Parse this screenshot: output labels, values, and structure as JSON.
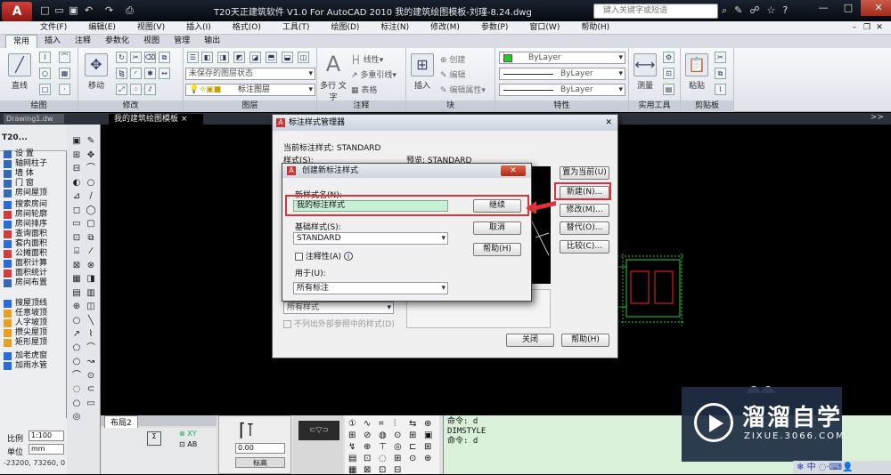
{
  "app": {
    "logo_letter": "A",
    "title": "T20天正建筑软件 V1.0 For AutoCAD 2010    我的建筑绘图模板-刘瑾-8.24.dwg",
    "search_placeholder": "键入关键字或短语"
  },
  "menu": [
    "文件(F)",
    "编辑(E)",
    "视图(V)",
    "插入(I)",
    "格式(O)",
    "工具(T)",
    "绘图(D)",
    "标注(N)",
    "修改(M)",
    "参数(P)",
    "窗口(W)",
    "帮助(H)"
  ],
  "ribbon_tabs": [
    "常用",
    "插入",
    "注释",
    "参数化",
    "视图",
    "管理",
    "输出"
  ],
  "ribbon": {
    "panels": [
      "绘图",
      "修改",
      "图层",
      "注释",
      "块",
      "特性",
      "实用工具",
      "剪贴板"
    ],
    "draw_big": "直线",
    "modify_big": "移动",
    "layer_state": "未保存的图层状态",
    "layer_name": "标注图层",
    "text_big": "多行\n文字",
    "linear": "线性",
    "multileader": "多重引线",
    "table": "表格",
    "insert_big": "插入",
    "create": "创建",
    "edit": "编辑",
    "edit_attr": "编辑属性",
    "bylayer": "ByLayer",
    "measure": "测量",
    "paste": "粘贴"
  },
  "doc_tabs": {
    "drawing1": "Drawing1.dw",
    "active": "我的建筑绘图模板"
  },
  "left_palette": {
    "header": "T20...",
    "items": [
      {
        "label": "设  置",
        "color": "#3469b5"
      },
      {
        "label": "轴网柱子",
        "color": "#3469b5"
      },
      {
        "label": "墙  体",
        "color": "#3469b5"
      },
      {
        "label": "门  窗",
        "color": "#3469b5"
      },
      {
        "label": "房间屋顶",
        "color": "#3469b5"
      },
      {
        "label": "搜索房间",
        "color": "#2a6bd6"
      },
      {
        "label": "房间轮廓",
        "color": "#d23c3c"
      },
      {
        "label": "房间排序",
        "color": "#2a6bd6"
      },
      {
        "label": "查询面积",
        "color": "#d23c3c"
      },
      {
        "label": "套内面积",
        "color": "#2a6bd6"
      },
      {
        "label": "公摊面积",
        "color": "#d23c3c"
      },
      {
        "label": "面积计算",
        "color": "#2a6bd6"
      },
      {
        "label": "面积统计",
        "color": "#d23c3c"
      },
      {
        "label": "房间布置",
        "color": "#3469b5"
      },
      {
        "label": "搜屋顶线",
        "color": "#2a6bd6"
      },
      {
        "label": "任意坡顶",
        "color": "#e8a020"
      },
      {
        "label": "人字坡顶",
        "color": "#e8a020"
      },
      {
        "label": "攒尖屋顶",
        "color": "#e8a020"
      },
      {
        "label": "矩形屋顶",
        "color": "#e8a020"
      },
      {
        "label": "加老虎窗",
        "color": "#2a6bd6"
      },
      {
        "label": "加雨水管",
        "color": "#2a6bd6"
      }
    ]
  },
  "status": {
    "ratio_label": "比例",
    "ratio_value": "1:100",
    "unit_label": "单位",
    "unit_value": "mm",
    "coords": "-23200, 73260, 0",
    "layout_tab": "布局2",
    "scale_value": "0.00",
    "elev_label": "标高"
  },
  "command": [
    "命令: d",
    "DIMSTYLE",
    "命令: d"
  ],
  "dim_manager": {
    "title": "标注样式管理器",
    "current_style": "当前标注样式: STANDARD",
    "styles_label": "样式(S):",
    "preview_label": "预览: STANDARD",
    "set_current": "置为当前(U)",
    "new": "新建(N)...",
    "modify": "修改(M)...",
    "override": "替代(O)...",
    "compare": "比较(C)...",
    "list_value": "所有样式",
    "exclude_xref": "不列出外部参照中的样式(D)",
    "close": "关闭",
    "help": "帮助(H)"
  },
  "new_dim": {
    "title": "创建新标注样式",
    "name_label": "新样式名(N):",
    "name_value": "我的标注样式",
    "base_label": "基础样式(S):",
    "base_value": "STANDARD",
    "annotative": "注释性(A)",
    "use_for": "用于(U):",
    "use_value": "所有标注",
    "continue": "继续",
    "cancel": "取消",
    "help": "帮助(H)"
  },
  "watermark": {
    "name": "溜溜自学",
    "url": "ZIXUE.3066.COM"
  },
  "tray": "中"
}
